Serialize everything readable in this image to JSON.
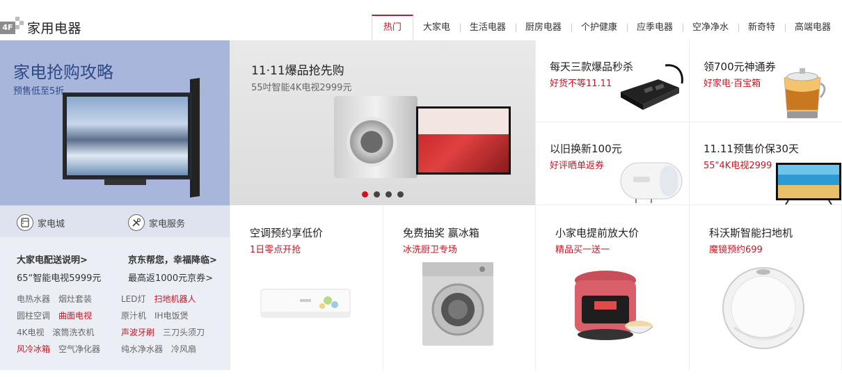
{
  "header": {
    "floor_badge": "4F",
    "title": "家用电器",
    "tabs": [
      {
        "label": "热门",
        "active": true
      },
      {
        "label": "大家电"
      },
      {
        "label": "生活电器"
      },
      {
        "label": "厨房电器"
      },
      {
        "label": "个护健康"
      },
      {
        "label": "应季电器"
      },
      {
        "label": "空净净水"
      },
      {
        "label": "新奇特"
      },
      {
        "label": "高端电器"
      }
    ]
  },
  "left": {
    "banner_title": "家电抢购攻略",
    "banner_sub": "预售低至5折",
    "services": [
      {
        "label": "家电城",
        "icon": "fridge-icon"
      },
      {
        "label": "家电服务",
        "icon": "tools-icon"
      }
    ],
    "promo_left_title": "大家电配送说明>",
    "promo_left_sub": "65“智能电视5999元",
    "promo_right_title": "京东帮您，幸福降临>",
    "promo_right_sub": "最高返1000元京券>",
    "links": [
      [
        {
          "label": "电热水器"
        },
        {
          "label": "烟灶套装"
        },
        {
          "label": "LED灯"
        },
        {
          "label": "扫地机器人",
          "red": true
        }
      ],
      [
        {
          "label": "圆柱空调"
        },
        {
          "label": "曲面电视",
          "red": true
        },
        {
          "label": "原汁机"
        },
        {
          "label": "IH电饭煲"
        }
      ],
      [
        {
          "label": "4K电视"
        },
        {
          "label": "滚筒洗衣机"
        },
        {
          "label": "声波牙刷",
          "red": true
        },
        {
          "label": "三刀头须刀"
        }
      ],
      [
        {
          "label": "风冷冰箱",
          "red": true
        },
        {
          "label": "空气净化器"
        },
        {
          "label": "纯水净水器"
        },
        {
          "label": "冷风扇"
        }
      ]
    ]
  },
  "carousel": {
    "title": "11·11爆品抢先购",
    "sub": "55吋智能4K电视2999元",
    "dots": 4,
    "active_dot": 0
  },
  "tiles": [
    {
      "title": "每天三款爆品秒杀",
      "sub": "好货不等11.11"
    },
    {
      "title": "领700元神通券",
      "sub": "好家电·百宝箱"
    },
    {
      "title": "以旧换新100元",
      "sub": "好评晒单返券"
    },
    {
      "title": "11.11预售价保30天",
      "sub": "55\"4K电视2999"
    }
  ],
  "bottom_tiles": [
    {
      "title": "空调预约享低价",
      "sub": "1日零点开抢"
    },
    {
      "title": "免费抽奖 赢冰箱",
      "sub": "冰洗厨卫专场"
    },
    {
      "title": "小家电提前放大价",
      "sub": "精品买一送一"
    },
    {
      "title": "科沃斯智能扫地机",
      "sub": "魔镜预约699"
    }
  ],
  "colors": {
    "accent": "#c81623",
    "banner_bg": "#a9b6db",
    "side_bg": "#eceef6"
  }
}
